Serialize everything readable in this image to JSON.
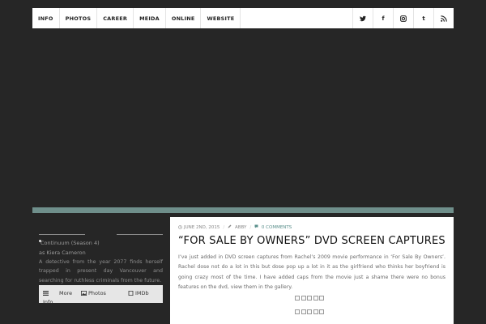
{
  "nav": {
    "items": [
      "INFO",
      "PHOTOS",
      "CAREER",
      "MEIDA",
      "ONLINE",
      "WEBSITE"
    ]
  },
  "social": {
    "icons": [
      "twitter-icon",
      "facebook-icon",
      "instagram-icon",
      "tumblr-icon",
      "rss-icon"
    ],
    "facebook_glyph": "f",
    "tumblr_glyph": "t"
  },
  "colors": {
    "accent": "#6f8f8b",
    "background": "#262626",
    "comments_link": "#5a8f8b"
  },
  "sidebar": {
    "project_title": "Continuum (Season 4)",
    "role": "as Kiera Cameron",
    "description": "A detective from the year 2077 finds herself trapped in present day Vancouver and searching for ruthless criminals from the future.",
    "links": {
      "more": "More",
      "photos": "Photos",
      "imdb": "IMDb",
      "info": "Info"
    }
  },
  "post": {
    "date": "JUNE 2ND, 2015",
    "author": "ABBY",
    "comments": "0 COMMENTS",
    "title": "“FOR SALE BY OWNERS” DVD SCREEN CAPTURES",
    "body": "I’ve just added in DVD screen captures from Rachel’s 2009 movie performance in ‘For Sale By Owners’. Rachel dose not do a lot in this but dose pop up a lot in it as the girlfriend who thinks her boyfriend is going crazy most of the time. I have added caps from the movie just a shame there were no bonus features on the dvd, view them in the gallery."
  }
}
